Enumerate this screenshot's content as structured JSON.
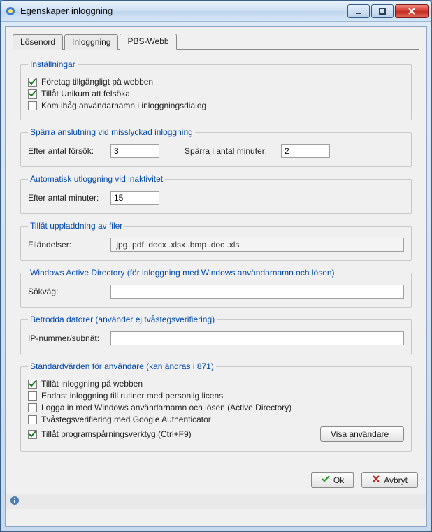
{
  "window": {
    "title": "Egenskaper inloggning"
  },
  "tabs": {
    "losenord": "Lösenord",
    "inloggning": "Inloggning",
    "pbswebb": "PBS-Webb"
  },
  "group_installningar": {
    "legend": "Inställningar",
    "fortag": {
      "label": "Företag tillgängligt på webben",
      "checked": true
    },
    "unikum": {
      "label": "Tillåt Unikum att felsöka",
      "checked": true
    },
    "komihag": {
      "label": "Kom ihåg användarnamn i inloggningsdialog",
      "checked": false
    }
  },
  "group_sparra": {
    "legend": "Spärra anslutning vid misslyckad inloggning",
    "forsok_label": "Efter antal försök:",
    "forsok_value": "3",
    "minuter_label": "Spärra i antal minuter:",
    "minuter_value": "2"
  },
  "group_auto": {
    "legend": "Automatisk utloggning vid inaktivitet",
    "minuter_label": "Efter antal minuter:",
    "minuter_value": "15"
  },
  "group_filer": {
    "legend": "Tillåt uppladdning av filer",
    "ext_label": "Filändelser:",
    "ext_value": ".jpg .pdf .docx .xlsx .bmp .doc .xls"
  },
  "group_ad": {
    "legend": "Windows Active Directory (för inloggning med Windows användarnamn och lösen)",
    "path_label": "Sökväg:",
    "path_value": ""
  },
  "group_betrodda": {
    "legend": "Betrodda datorer (använder ej tvåstegsverifiering)",
    "ip_label": "IP-nummer/subnät:",
    "ip_value": ""
  },
  "group_std": {
    "legend": "Standardvärden för användare (kan ändras i 871)",
    "inlogg": {
      "label": "Tillåt inloggning på webben",
      "checked": true
    },
    "endast": {
      "label": "Endast inloggning till rutiner med personlig licens",
      "checked": false
    },
    "adwin": {
      "label": "Logga in med Windows användarnamn och lösen (Active Directory)",
      "checked": false
    },
    "gauth": {
      "label": "Tvåstegsverifiering med Google Authenticator",
      "checked": false
    },
    "trace": {
      "label": "Tillåt programspårningsverktyg (Ctrl+F9)",
      "checked": true
    },
    "visa_btn": "Visa användare"
  },
  "buttons": {
    "ok": "Ok",
    "avbryt": "Avbryt"
  }
}
